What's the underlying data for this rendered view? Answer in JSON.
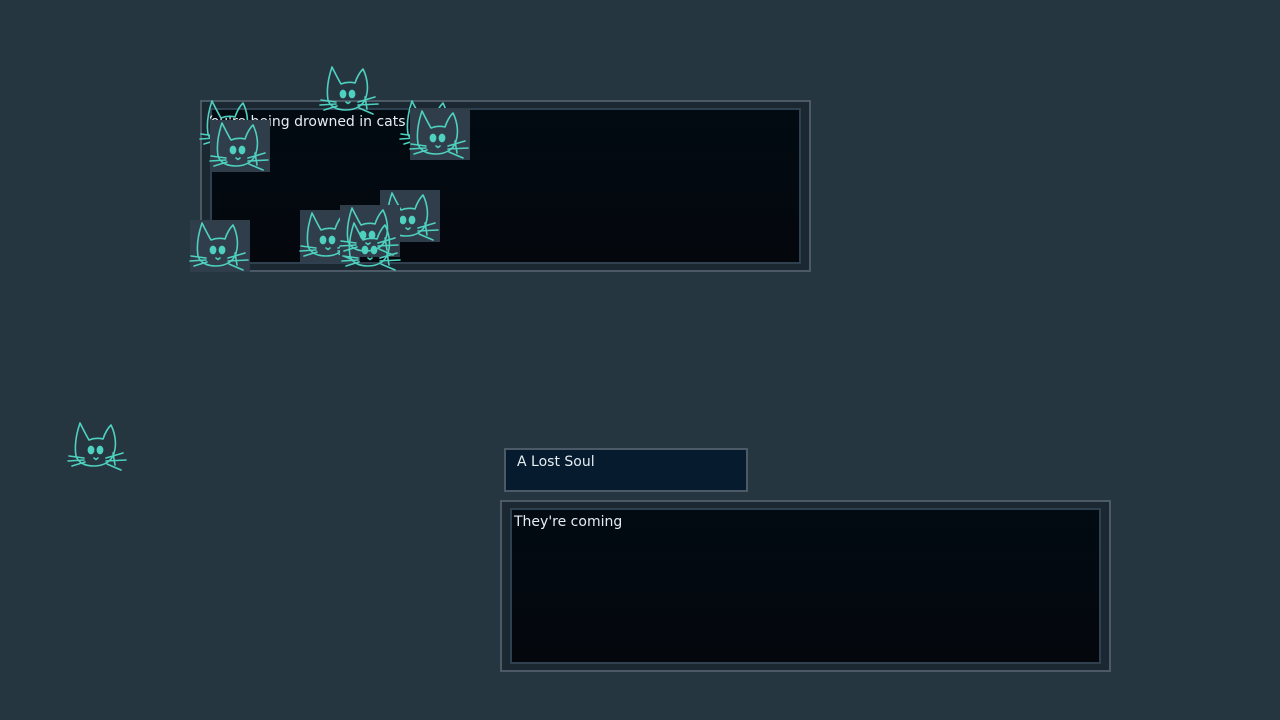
{
  "scene": {
    "title_panel": {
      "text": "You're being drowned in cats"
    },
    "speaker": {
      "name": "A Lost Soul"
    },
    "dialogue": {
      "text": "They're coming"
    },
    "sprites": {
      "icon": "cat-face-icon",
      "color": "#4fd1c0"
    }
  }
}
